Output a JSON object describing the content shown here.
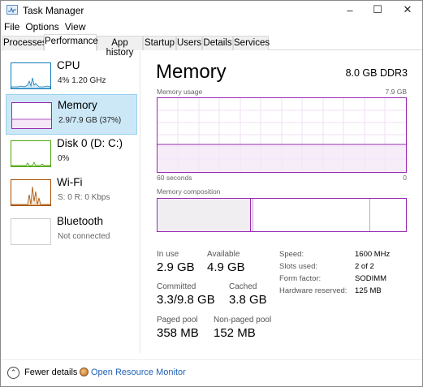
{
  "window": {
    "title": "Task Manager"
  },
  "menu": [
    "File",
    "Options",
    "View"
  ],
  "tabs": [
    "Processes",
    "Performance",
    "App history",
    "Startup",
    "Users",
    "Details",
    "Services"
  ],
  "active_tab": "Performance",
  "sidebar": [
    {
      "name": "CPU",
      "sub": "4%  1.20 GHz"
    },
    {
      "name": "Memory",
      "sub": "2.9/7.9 GB (37%)"
    },
    {
      "name": "Disk 0 (D: C:)",
      "sub": "0%"
    },
    {
      "name": "Wi-Fi",
      "sub": "S: 0  R: 0 Kbps"
    },
    {
      "name": "Bluetooth",
      "sub": "Not connected"
    }
  ],
  "memory": {
    "title": "Memory",
    "spec": "8.0 GB DDR3",
    "usage_label": "Memory usage",
    "usage_max": "7.9 GB",
    "time_left": "60 seconds",
    "time_right": "0",
    "usage_fraction": 0.37,
    "composition_label": "Memory composition",
    "in_use_label": "In use",
    "in_use": "2.9 GB",
    "available_label": "Available",
    "available": "4.9 GB",
    "committed_label": "Committed",
    "committed": "3.3/9.8 GB",
    "cached_label": "Cached",
    "cached": "3.8 GB",
    "paged_label": "Paged pool",
    "paged": "358 MB",
    "nonpaged_label": "Non-paged pool",
    "nonpaged": "152 MB",
    "specs": [
      {
        "label": "Speed:",
        "value": "1600 MHz"
      },
      {
        "label": "Slots used:",
        "value": "2 of 2"
      },
      {
        "label": "Form factor:",
        "value": "SODIMM"
      },
      {
        "label": "Hardware reserved:",
        "value": "125 MB"
      }
    ]
  },
  "footer": {
    "fewer": "Fewer details",
    "monitor": "Open Resource Monitor"
  },
  "colors": {
    "memory": "#9928b3",
    "cpu": "#117dbb",
    "disk": "#4da60c",
    "wifi": "#a74f01",
    "selected_bg": "#cce8f7"
  }
}
